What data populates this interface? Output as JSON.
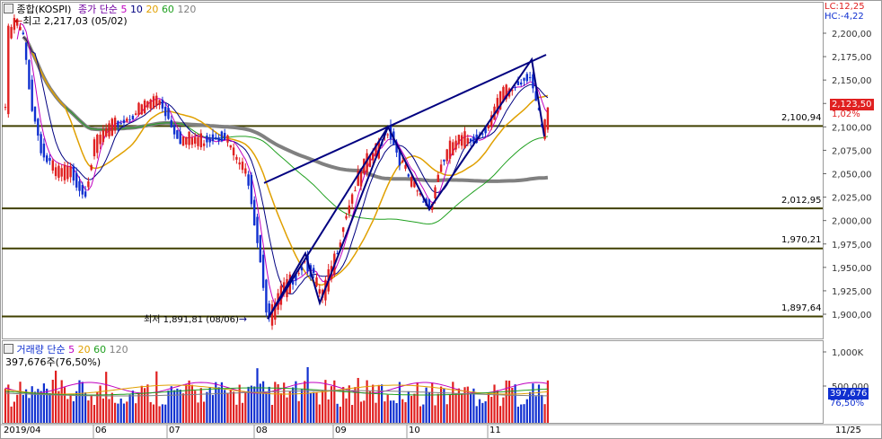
{
  "price_panel": {
    "title": "종합(KOSPI)",
    "indicator_label": "종가 단순",
    "ma_periods": [
      "5",
      "10",
      "20",
      "60",
      "120"
    ],
    "ma_colors": [
      "#c000c0",
      "#000080",
      "#e0a000",
      "#20a020",
      "#808080"
    ],
    "high_note": "최고 2,217,03 (05/02)",
    "low_note": "최저 1,891,81 (08/06)",
    "lc": "LC:12,25",
    "hc": "HC:-4,22",
    "last_price": "2,123,50",
    "last_pct": "1,02%",
    "hline_labels": [
      "2,100,94",
      "2,012,95",
      "1,970,21",
      "1,897,64"
    ]
  },
  "volume_panel": {
    "title": "거래량 단순",
    "ma_periods": [
      "5",
      "20",
      "60",
      "120"
    ],
    "ma_colors": [
      "#c000c0",
      "#e0a000",
      "#20a020",
      "#808080"
    ],
    "current": "397,676주(76,50%)",
    "last_volume": "397,676",
    "last_pct": "76,50%"
  },
  "x_axis": {
    "labels": [
      "2019/04",
      "06",
      "07",
      "08",
      "09",
      "10",
      "11"
    ],
    "right_label": "11/25"
  },
  "colors": {
    "up": "#e02020",
    "down": "#1030d0",
    "hline": "#404000",
    "trend": "#000080"
  },
  "chart_data": [
    {
      "type": "candlestick",
      "title": "종합(KOSPI)",
      "x_range": [
        "2019/04",
        "11/25"
      ],
      "y_ticks": [
        1900,
        1925,
        1950,
        1975,
        2000,
        2025,
        2050,
        2075,
        2100,
        2125,
        2150,
        2175,
        2200
      ],
      "ylim": [
        1880,
        2225
      ],
      "close_path": [
        {
          "x": "2019/04 start",
          "close": 2205
        },
        {
          "x": "05/02",
          "close": 2217.03
        },
        {
          "x": "05 mid",
          "close": 2095
        },
        {
          "x": "05 end",
          "close": 2030
        },
        {
          "x": "06 early",
          "close": 2110
        },
        {
          "x": "06 mid",
          "close": 2128
        },
        {
          "x": "06 end",
          "close": 2145
        },
        {
          "x": "07 early",
          "close": 2080
        },
        {
          "x": "07 mid",
          "close": 2095
        },
        {
          "x": "07 end",
          "close": 2050
        },
        {
          "x": "08/06",
          "close": 1891.81
        },
        {
          "x": "08 mid",
          "close": 1960
        },
        {
          "x": "08 end",
          "close": 1920
        },
        {
          "x": "09 mid",
          "close": 2050
        },
        {
          "x": "09 end",
          "close": 2100
        },
        {
          "x": "10 mid",
          "close": 2015
        },
        {
          "x": "10 end",
          "close": 2090
        },
        {
          "x": "11 early",
          "close": 2140
        },
        {
          "x": "11 mid",
          "close": 2170
        },
        {
          "x": "11/25",
          "close": 2123.5
        }
      ],
      "support_lines": [
        2100.94,
        2012.95,
        1970.21,
        1897.64
      ],
      "annotations": [
        "최고 2,217,03 (05/02)",
        "최저 1,891,81 (08/06)"
      ]
    },
    {
      "type": "bar",
      "title": "거래량",
      "y_ticks": [
        "1,000K",
        "500,000"
      ],
      "last_value": 397676,
      "last_pct": 76.5
    }
  ]
}
